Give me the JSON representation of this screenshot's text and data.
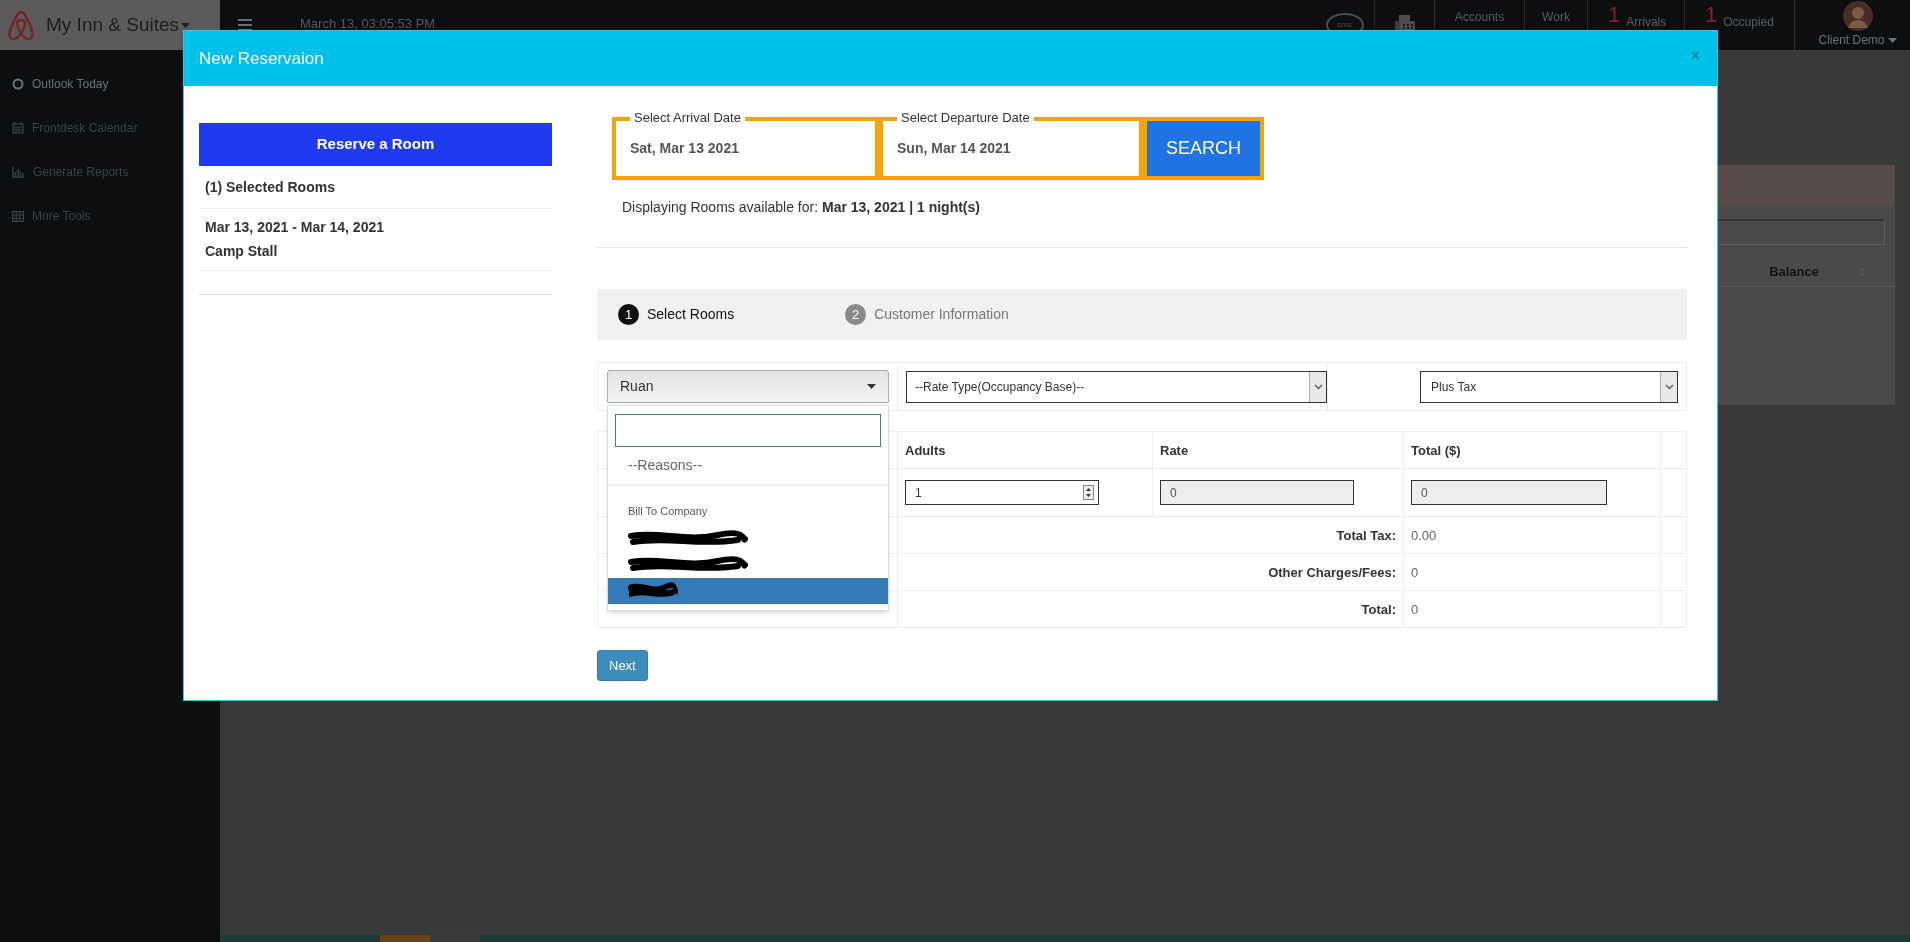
{
  "top_bar": {
    "brand": "My Inn & Suites",
    "datetime": "March 13, 03:05:53 PM",
    "sms_label": "sms",
    "links": [
      "Accounts",
      "Work"
    ],
    "counters": [
      {
        "count": "1",
        "label": "Arrivals"
      },
      {
        "count": "1",
        "label": "Occupied"
      }
    ],
    "user": "Client Demo"
  },
  "sidebar": {
    "items": [
      {
        "kind": "circle",
        "label": "Outlook Today",
        "selected": true
      },
      {
        "kind": "calendar",
        "label": "Frontdesk Calendar",
        "selected": false
      },
      {
        "kind": "chart",
        "label": "Generate Reports",
        "selected": false
      },
      {
        "kind": "grid",
        "label": "More Tools",
        "selected": false
      }
    ]
  },
  "background_panel": {
    "column": "Balance"
  },
  "modal": {
    "title": "New Reservaion",
    "close": "×",
    "reserve_button": "Reserve a Room",
    "selected_heading": "(1) Selected Rooms",
    "selection": {
      "dates": "Mar 13, 2021 - Mar 14, 2021",
      "room": "Camp Stall"
    },
    "arrival": {
      "label": "Select Arrival Date",
      "value": "Sat, Mar 13 2021"
    },
    "departure": {
      "label": "Select Departure Date",
      "value": "Sun, Mar 14 2021"
    },
    "search_button": "SEARCH",
    "availability": "Displaying Rooms available for: **Mar 13, 2021 | 1 night(s)**",
    "steps": [
      {
        "number": "1",
        "label": "Select Rooms",
        "selected": true
      },
      {
        "number": "2",
        "label": "Customer Information",
        "selected": false
      }
    ],
    "reason_select": {
      "value": "Ruan",
      "expanded": true,
      "options": [
        {
          "kind": "placeholder",
          "label": "--Reasons--"
        },
        {
          "kind": "group",
          "label": "Bill To Company"
        },
        {
          "kind": "redacted",
          "selected": false
        },
        {
          "kind": "redacted",
          "selected": false
        },
        {
          "kind": "redacted",
          "selected": true
        }
      ]
    },
    "rate_type": "--Rate Type(Occupancy Base)--",
    "tax_mode": "Plus Tax",
    "table": {
      "columns": [
        "Adults",
        "Rate",
        "Total ($)"
      ],
      "row": {
        "adults": "1",
        "rate": "0",
        "total": "0"
      },
      "summary": [
        {
          "label": "Total Tax:",
          "value": "0.00"
        },
        {
          "label": "Other Charges/Fees:",
          "value": "0"
        },
        {
          "label": "Total:",
          "value": "0"
        }
      ]
    },
    "next_button": "Next"
  }
}
